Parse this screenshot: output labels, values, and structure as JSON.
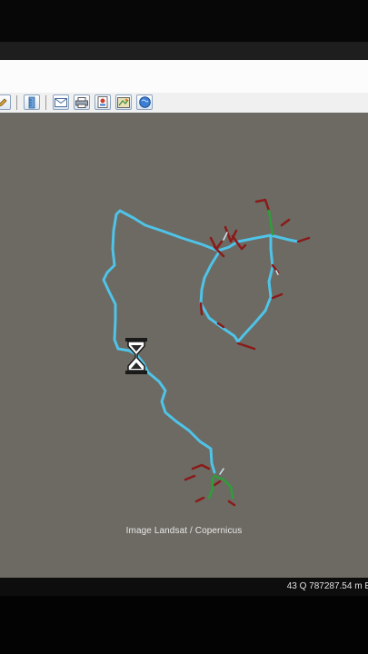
{
  "toolbar": {
    "icons": [
      "edit-icon",
      "ruler-icon",
      "email-icon",
      "print-icon",
      "save-image-icon",
      "view-in-maps-icon",
      "globe-icon"
    ]
  },
  "map": {
    "attribution": "Image Landsat / Copernicus",
    "track_color": "#4fc3e8",
    "marker_color_red": "#8b1a1a",
    "marker_color_green": "#2e9e3a",
    "background": "#6c6a62"
  },
  "statusbar": {
    "coordinates": "43 Q 787287.54 m E"
  }
}
